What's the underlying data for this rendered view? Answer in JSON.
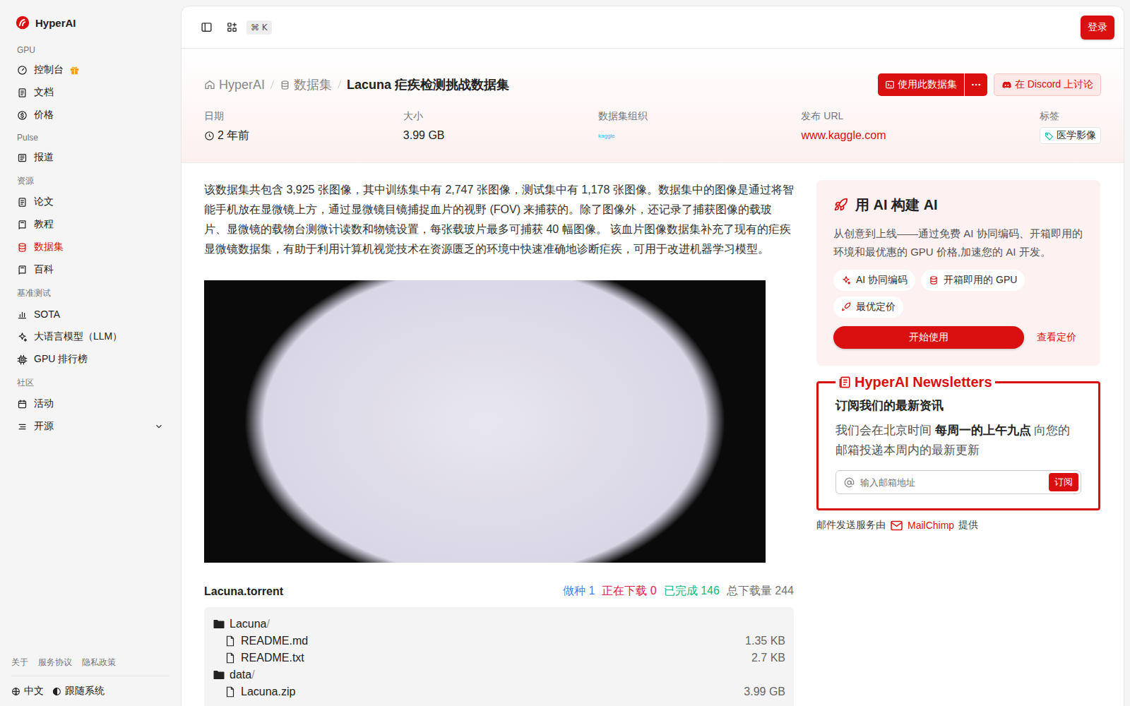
{
  "sidebar": {
    "brand": "HyperAI",
    "sections": [
      {
        "label": "GPU",
        "items": [
          {
            "label": "控制台",
            "selected": false,
            "gift": true
          },
          {
            "label": "文档",
            "selected": false,
            "gift": false
          },
          {
            "label": "价格",
            "selected": false,
            "gift": false
          }
        ]
      },
      {
        "label": "Pulse",
        "items": [
          {
            "label": "报道",
            "selected": false,
            "gift": false
          }
        ]
      },
      {
        "label": "资源",
        "items": [
          {
            "label": "论文",
            "selected": false,
            "gift": false
          },
          {
            "label": "教程",
            "selected": false,
            "gift": false
          },
          {
            "label": "数据集",
            "selected": true,
            "gift": false
          },
          {
            "label": "百科",
            "selected": false,
            "gift": false
          }
        ]
      },
      {
        "label": "基准测试",
        "items": [
          {
            "label": "SOTA",
            "selected": false,
            "gift": false
          },
          {
            "label": "大语言模型（LLM）",
            "selected": false,
            "gift": false
          },
          {
            "label": "GPU 排行榜",
            "selected": false,
            "gift": false
          }
        ]
      },
      {
        "label": "社区",
        "items": [
          {
            "label": "活动",
            "selected": false,
            "gift": false
          },
          {
            "label": "开源",
            "selected": false,
            "gift": false,
            "expanded": false
          }
        ]
      }
    ],
    "footer_links": [
      "关于",
      "服务协议",
      "隐私政策"
    ],
    "language": "中文",
    "theme": "跟随系统"
  },
  "topbar": {
    "shortcut": "⌘ K",
    "login": "登录"
  },
  "breadcrumb": [
    {
      "label": "HyperAI",
      "current": false
    },
    {
      "label": "数据集",
      "current": false
    },
    {
      "label": "Lacuna 疟疾检测挑战数据集",
      "current": true
    }
  ],
  "actions": {
    "use": "使用此数据集",
    "discord": "在 Discord 上讨论"
  },
  "meta": [
    {
      "label": "日期",
      "value": "2 年前",
      "kind": "time"
    },
    {
      "label": "大小",
      "value": "3.99 GB",
      "kind": "text"
    },
    {
      "label": "数据集组织",
      "value": "kaggle",
      "kind": "logo"
    },
    {
      "label": "发布 URL",
      "value": "www.kaggle.com",
      "kind": "link"
    },
    {
      "label": "标签",
      "value": "医学影像",
      "kind": "tag"
    }
  ],
  "description": "该数据集共包含 3,925 张图像，其中训练集中有 2,747 张图像，测试集中有 1,178 张图像。数据集中的图像是通过将智能手机放在显微镜上方，通过显微镜目镜捕捉血片的视野 (FOV) 来捕获的。除了图像外，还记录了捕获图像的载玻片、显微镜的载物台测微计读数和物镜设置，每张载玻片最多可捕获 40 幅图像。 该血片图像数据集补充了现有的疟疾显微镜数据集，有助于利用计算机视觉技术在资源匮乏的环境中快速准确地诊断疟疾，可用于改进机器学习模型。",
  "torrent": {
    "name": "Lacuna.torrent",
    "stats": [
      {
        "label": "做种",
        "value": "1",
        "color": "#3b82f6"
      },
      {
        "label": "正在下载",
        "value": "0",
        "color": "#e11d48"
      },
      {
        "label": "已完成",
        "value": "146",
        "color": "#10b981"
      },
      {
        "label": "总下载量",
        "value": "244",
        "color": "#737373"
      }
    ],
    "files": [
      {
        "name": "Lacuna",
        "suffix": "/",
        "kind": "folder",
        "depth": 0
      },
      {
        "name": "README.md",
        "kind": "file",
        "depth": 1,
        "size": "1.35 KB"
      },
      {
        "name": "README.txt",
        "kind": "file",
        "depth": 1,
        "size": "2.7 KB"
      },
      {
        "name": "data",
        "suffix": "/",
        "kind": "folder",
        "depth": 0
      },
      {
        "name": "Lacuna.zip",
        "kind": "file",
        "depth": 1,
        "size": "3.99 GB"
      }
    ]
  },
  "promo": {
    "title": "用 AI 构建 AI",
    "text": "从创意到上线——通过免费 AI 协同编码、开箱即用的环境和最优惠的 GPU 价格,加速您的 AI 开发。",
    "chips": [
      "AI 协同编码",
      "开箱即用的 GPU",
      "最优定价"
    ],
    "primary": "开始使用",
    "secondary": "查看定价"
  },
  "newsletter": {
    "title": "HyperAI Newsletters",
    "heading": "订阅我们的最新资讯",
    "text_before": "我们会在北京时间 ",
    "text_bold": "每周一的上午九点",
    "text_after": " 向您的邮箱投递本周内的最新更新",
    "placeholder": "输入邮箱地址",
    "button": "订阅",
    "credit_before": "邮件发送服务由",
    "credit_brand": "MailChimp",
    "credit_after": "提供"
  }
}
